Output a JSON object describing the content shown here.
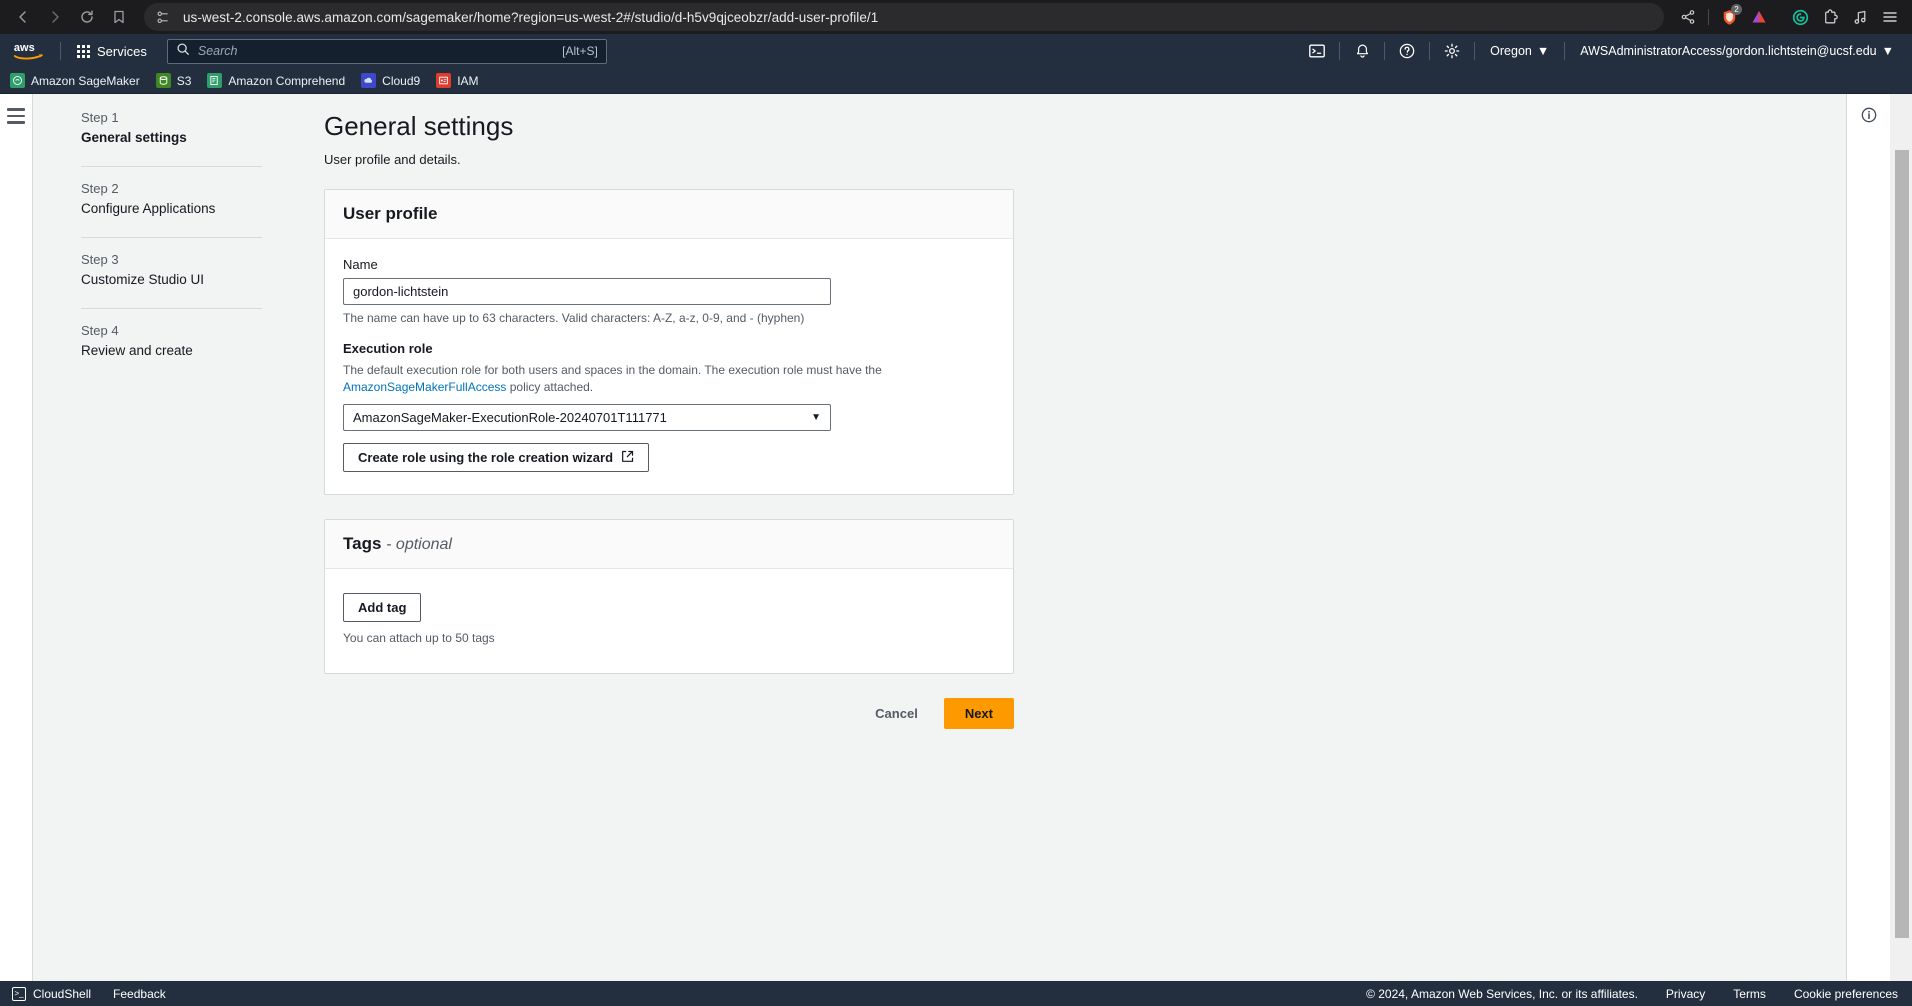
{
  "browser": {
    "back_icon": "back-arrow-icon",
    "forward_icon": "forward-arrow-icon",
    "reload_icon": "reload-icon",
    "bookmark_icon": "bookmark-icon",
    "url": "us-west-2.console.aws.amazon.com/sagemaker/home?region=us-west-2#/studio/d-h5v9qjceobzr/add-user-profile/1",
    "shield_icon": "site-settings-icon",
    "extensions": [
      {
        "name": "share-icon"
      },
      {
        "name": "brave-shields-icon",
        "badge": "2"
      },
      {
        "name": "triangle-extension-icon"
      },
      {
        "name": "grammarly-icon"
      },
      {
        "name": "extensions-puzzle-icon"
      },
      {
        "name": "music-note-icon"
      },
      {
        "name": "browser-menu-icon"
      }
    ]
  },
  "aws_header": {
    "logo": "aws-logo",
    "services_label": "Services",
    "services_icon": "grid-menu-icon",
    "search_placeholder": "Search",
    "search_value": "",
    "search_icon": "search-icon",
    "search_shortcut": "[Alt+S]",
    "cloudshell_icon": "cloudshell-icon",
    "notifications_icon": "bell-icon",
    "help_icon": "question-circle-icon",
    "settings_icon": "gear-icon",
    "region_label": "Oregon",
    "account_label": "AWSAdministratorAccess/gordon.lichtstein@ucsf.edu"
  },
  "bookmarks": [
    {
      "label": "Amazon SageMaker",
      "icon": "sagemaker-icon",
      "color": "#2e9e6b",
      "glyph": "⚛"
    },
    {
      "label": "S3",
      "icon": "s3-icon",
      "color": "#3f8624",
      "glyph": "▤"
    },
    {
      "label": "Amazon Comprehend",
      "icon": "comprehend-icon",
      "color": "#2e9e6b",
      "glyph": "☰"
    },
    {
      "label": "Cloud9",
      "icon": "cloud9-icon",
      "color": "#3f48cc",
      "glyph": "☁"
    },
    {
      "label": "IAM",
      "icon": "iam-icon",
      "color": "#dd3c2f",
      "glyph": "⌸"
    }
  ],
  "sidebar": {
    "menu_icon": "hamburger-menu-icon",
    "steps": [
      {
        "num": "Step 1",
        "label": "General settings",
        "active": true
      },
      {
        "num": "Step 2",
        "label": "Configure Applications",
        "active": false
      },
      {
        "num": "Step 3",
        "label": "Customize Studio UI",
        "active": false
      },
      {
        "num": "Step 4",
        "label": "Review and create",
        "active": false
      }
    ]
  },
  "main": {
    "title": "General settings",
    "subtitle": "User profile and details.",
    "user_profile_card": {
      "heading": "User profile",
      "name_label": "Name",
      "name_value": "gordon-lichtstein",
      "name_hint": "The name can have up to 63 characters. Valid characters: A-Z, a-z, 0-9, and - (hyphen)",
      "role_label": "Execution role",
      "role_desc_before": "The default execution role for both users and spaces in the domain. The execution role must have the ",
      "role_desc_link": "AmazonSageMakerFullAccess",
      "role_desc_after": " policy attached.",
      "role_selected": "AmazonSageMaker-ExecutionRole-20240701T111771",
      "role_caret_icon": "chevron-down-icon",
      "create_role_button": "Create role using the role creation wizard",
      "external_link_icon": "external-link-icon"
    },
    "tags_card": {
      "heading": "Tags",
      "heading_optional": "- optional",
      "add_tag_button": "Add tag",
      "hint": "You can attach up to 50 tags"
    },
    "actions": {
      "cancel_label": "Cancel",
      "next_label": "Next"
    },
    "info_icon": "info-circle-icon"
  },
  "footer": {
    "cloudshell_label": "CloudShell",
    "cloudshell_icon": "cloudshell-icon",
    "feedback_label": "Feedback",
    "copyright": "© 2024, Amazon Web Services, Inc. or its affiliates.",
    "privacy_label": "Privacy",
    "terms_label": "Terms",
    "cookie_label": "Cookie preferences"
  },
  "colors": {
    "aws_navy": "#232f3e",
    "aws_orange": "#ff9900",
    "link_blue": "#0073bb",
    "page_bg": "#f2f3f3"
  }
}
